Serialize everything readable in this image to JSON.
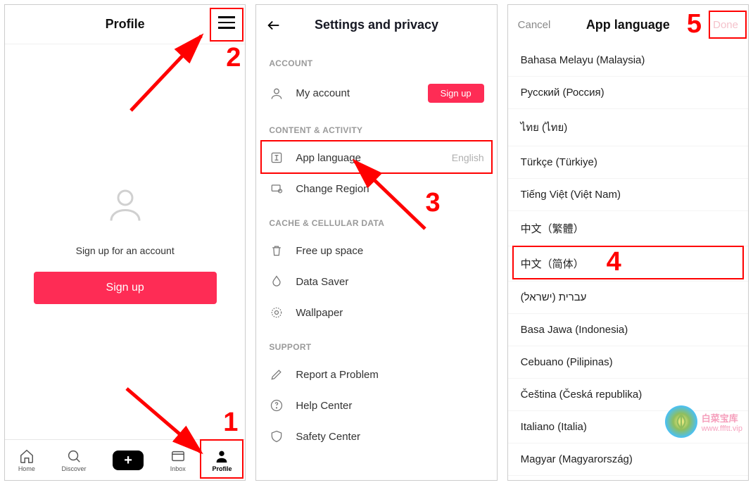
{
  "annotations": {
    "n1": "1",
    "n2": "2",
    "n3": "3",
    "n4": "4",
    "n5": "5"
  },
  "screen1": {
    "title": "Profile",
    "signup_prompt": "Sign up for an account",
    "signup_button": "Sign up",
    "tabs": {
      "home": "Home",
      "discover": "Discover",
      "inbox": "Inbox",
      "profile": "Profile"
    }
  },
  "screen2": {
    "title": "Settings and privacy",
    "sections": {
      "account": "ACCOUNT",
      "content": "CONTENT & ACTIVITY",
      "cache": "CACHE & CELLULAR DATA",
      "support": "SUPPORT"
    },
    "rows": {
      "my_account": "My account",
      "my_account_signup": "Sign up",
      "app_language": "App language",
      "app_language_value": "English",
      "change_region": "Change Region",
      "free_up_space": "Free up space",
      "data_saver": "Data Saver",
      "wallpaper": "Wallpaper",
      "report_problem": "Report a Problem",
      "help_center": "Help Center",
      "safety_center": "Safety Center"
    }
  },
  "screen3": {
    "cancel": "Cancel",
    "title": "App language",
    "done": "Done",
    "languages": [
      "Bahasa Melayu (Malaysia)",
      "Русский (Россия)",
      "ไทย (ไทย)",
      "Türkçe (Türkiye)",
      "Tiếng Việt (Việt Nam)",
      "中文（繁體）",
      "中文（简体）",
      "עברית (ישראל)",
      "Basa Jawa (Indonesia)",
      "Cebuano (Pilipinas)",
      "Čeština (Česká republika)",
      "Italiano (Italia)",
      "Magyar (Magyarország)"
    ]
  },
  "watermark": {
    "line1": "白菜宝库",
    "line2": "www.ffftt.vip"
  }
}
